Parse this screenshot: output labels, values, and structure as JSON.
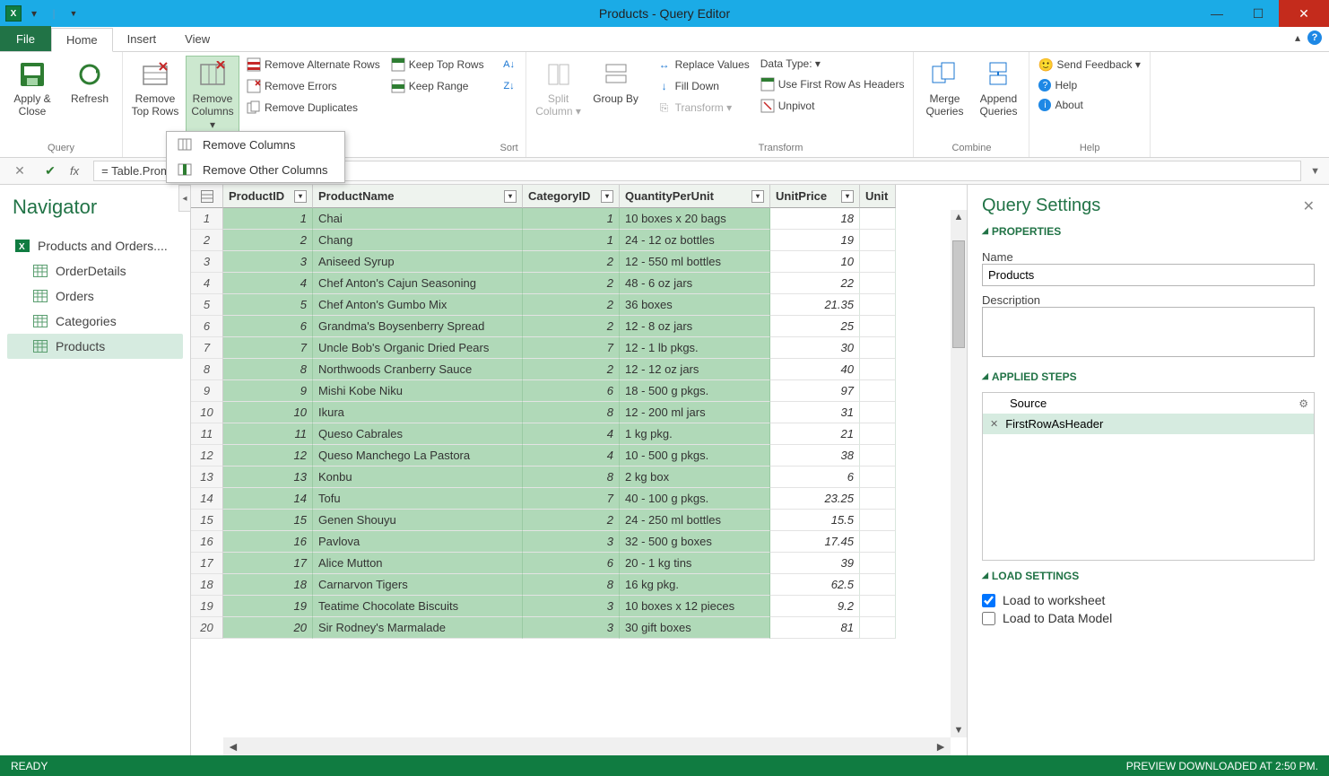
{
  "window": {
    "title": "Products - Query Editor"
  },
  "tabs": {
    "file": "File",
    "items": [
      "Home",
      "Insert",
      "View"
    ],
    "active": "Home"
  },
  "ribbon": {
    "query": {
      "label": "Query",
      "apply_close": "Apply & Close",
      "refresh": "Refresh"
    },
    "reduce": {
      "remove_top_rows": "Remove Top Rows",
      "remove_columns": "Remove Columns ▾",
      "remove_alternate_rows": "Remove Alternate Rows",
      "remove_errors": "Remove Errors",
      "remove_duplicates": "Remove Duplicates",
      "keep_top_rows": "Keep Top Rows",
      "keep_range": "Keep Range"
    },
    "sort": {
      "label": "Sort"
    },
    "split": {
      "split_column": "Split Column ▾",
      "group_by": "Group By"
    },
    "transform": {
      "label": "Transform",
      "replace_values": "Replace Values",
      "fill_down": "Fill Down",
      "transform": "Transform ▾",
      "data_type": "Data Type: ▾",
      "first_row_headers": "Use First Row As Headers",
      "unpivot": "Unpivot"
    },
    "combine": {
      "label": "Combine",
      "merge": "Merge Queries",
      "append": "Append Queries"
    },
    "help": {
      "label": "Help",
      "send_feedback": "Send Feedback ▾",
      "help": "Help",
      "about": "About"
    }
  },
  "dropdown": {
    "items": [
      "Remove Columns",
      "Remove Other Columns"
    ]
  },
  "formula": {
    "text": "= Table.PromoteHeaders(Products)"
  },
  "navigator": {
    "title": "Navigator",
    "root": "Products and Orders....",
    "items": [
      "OrderDetails",
      "Orders",
      "Categories",
      "Products"
    ],
    "selected": "Products"
  },
  "grid": {
    "columns": [
      "ProductID",
      "ProductName",
      "CategoryID",
      "QuantityPerUnit",
      "UnitPrice",
      "Unit"
    ],
    "rows": [
      {
        "n": 1,
        "id": 1,
        "name": "Chai",
        "cat": 1,
        "qty": "10 boxes x 20 bags",
        "price": "18"
      },
      {
        "n": 2,
        "id": 2,
        "name": "Chang",
        "cat": 1,
        "qty": "24 - 12 oz bottles",
        "price": "19"
      },
      {
        "n": 3,
        "id": 3,
        "name": "Aniseed Syrup",
        "cat": 2,
        "qty": "12 - 550 ml bottles",
        "price": "10"
      },
      {
        "n": 4,
        "id": 4,
        "name": "Chef Anton's Cajun Seasoning",
        "cat": 2,
        "qty": "48 - 6 oz jars",
        "price": "22"
      },
      {
        "n": 5,
        "id": 5,
        "name": "Chef Anton's Gumbo Mix",
        "cat": 2,
        "qty": "36 boxes",
        "price": "21.35"
      },
      {
        "n": 6,
        "id": 6,
        "name": "Grandma's Boysenberry Spread",
        "cat": 2,
        "qty": "12 - 8 oz jars",
        "price": "25"
      },
      {
        "n": 7,
        "id": 7,
        "name": "Uncle Bob's Organic Dried Pears",
        "cat": 7,
        "qty": "12 - 1 lb pkgs.",
        "price": "30"
      },
      {
        "n": 8,
        "id": 8,
        "name": "Northwoods Cranberry Sauce",
        "cat": 2,
        "qty": "12 - 12 oz jars",
        "price": "40"
      },
      {
        "n": 9,
        "id": 9,
        "name": "Mishi Kobe Niku",
        "cat": 6,
        "qty": "18 - 500 g pkgs.",
        "price": "97"
      },
      {
        "n": 10,
        "id": 10,
        "name": "Ikura",
        "cat": 8,
        "qty": "12 - 200 ml jars",
        "price": "31"
      },
      {
        "n": 11,
        "id": 11,
        "name": "Queso Cabrales",
        "cat": 4,
        "qty": "1 kg pkg.",
        "price": "21"
      },
      {
        "n": 12,
        "id": 12,
        "name": "Queso Manchego La Pastora",
        "cat": 4,
        "qty": "10 - 500 g pkgs.",
        "price": "38"
      },
      {
        "n": 13,
        "id": 13,
        "name": "Konbu",
        "cat": 8,
        "qty": "2 kg box",
        "price": "6"
      },
      {
        "n": 14,
        "id": 14,
        "name": "Tofu",
        "cat": 7,
        "qty": "40 - 100 g pkgs.",
        "price": "23.25"
      },
      {
        "n": 15,
        "id": 15,
        "name": "Genen Shouyu",
        "cat": 2,
        "qty": "24 - 250 ml bottles",
        "price": "15.5"
      },
      {
        "n": 16,
        "id": 16,
        "name": "Pavlova",
        "cat": 3,
        "qty": "32 - 500 g boxes",
        "price": "17.45"
      },
      {
        "n": 17,
        "id": 17,
        "name": "Alice Mutton",
        "cat": 6,
        "qty": "20 - 1 kg tins",
        "price": "39"
      },
      {
        "n": 18,
        "id": 18,
        "name": "Carnarvon Tigers",
        "cat": 8,
        "qty": "16 kg pkg.",
        "price": "62.5"
      },
      {
        "n": 19,
        "id": 19,
        "name": "Teatime Chocolate Biscuits",
        "cat": 3,
        "qty": "10 boxes x 12 pieces",
        "price": "9.2"
      },
      {
        "n": 20,
        "id": 20,
        "name": "Sir Rodney's Marmalade",
        "cat": 3,
        "qty": "30 gift boxes",
        "price": "81"
      }
    ]
  },
  "settings": {
    "title": "Query Settings",
    "properties": "PROPERTIES",
    "name_label": "Name",
    "name_value": "Products",
    "description_label": "Description",
    "applied_steps": "APPLIED STEPS",
    "steps": [
      "Source",
      "FirstRowAsHeader"
    ],
    "selected_step": "FirstRowAsHeader",
    "load_settings": "LOAD SETTINGS",
    "load_worksheet": "Load to worksheet",
    "load_datamodel": "Load to Data Model"
  },
  "status": {
    "ready": "READY",
    "preview": "PREVIEW DOWNLOADED AT 2:50 PM."
  }
}
